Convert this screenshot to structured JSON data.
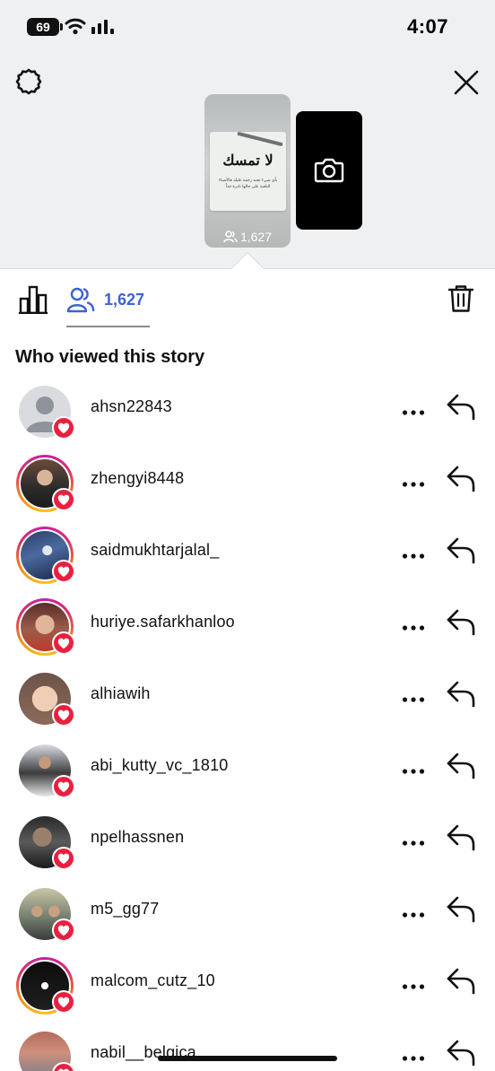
{
  "status_bar": {
    "battery": "69",
    "time": "4:07"
  },
  "header": {
    "settings_icon": "gear-icon",
    "close_icon": "close-icon"
  },
  "story_preview": {
    "arabic_title": "لا تمسك",
    "arabic_sub": "بأي شيء تحبه رحمة عليك فالأشياء الباقية على حالها نادرة جداً",
    "views": "1,627",
    "add_story_icon": "camera-icon"
  },
  "tabs": {
    "insights_icon": "bar-chart-icon",
    "viewers_icon": "people-icon",
    "viewers_count": "1,627",
    "delete_icon": "trash-icon"
  },
  "section_title": "Who viewed this story",
  "viewers": [
    {
      "username": "ahsn22843",
      "ring": false,
      "avatar": "default",
      "reaction": "heart"
    },
    {
      "username": "zhengyi8448",
      "ring": true,
      "avatar": "photo",
      "reaction": "heart"
    },
    {
      "username": "saidmukhtarjalal_",
      "ring": true,
      "avatar": "photo",
      "reaction": "heart"
    },
    {
      "username": "huriye.safarkhanloo",
      "ring": true,
      "avatar": "photo",
      "reaction": "heart"
    },
    {
      "username": "alhiawih",
      "ring": false,
      "avatar": "photo",
      "reaction": "heart"
    },
    {
      "username": "abi_kutty_vc_1810",
      "ring": false,
      "avatar": "photo",
      "reaction": "heart"
    },
    {
      "username": "npelhassnen",
      "ring": false,
      "avatar": "photo",
      "reaction": "heart"
    },
    {
      "username": "m5_gg77",
      "ring": false,
      "avatar": "photo",
      "reaction": "heart"
    },
    {
      "username": "malcom_cutz_10",
      "ring": true,
      "avatar": "photo",
      "reaction": "heart"
    },
    {
      "username": "nabil__belgica",
      "ring": false,
      "avatar": "photo",
      "reaction": "heart"
    }
  ],
  "colors": {
    "accent_blue": "#3c63d3",
    "heart_red": "#e8203f"
  }
}
